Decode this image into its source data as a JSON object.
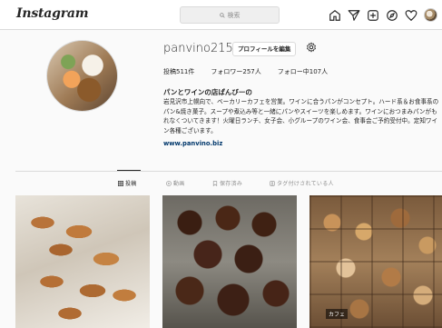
{
  "header": {
    "logo": "Instagram",
    "search_placeholder": "検索"
  },
  "profile": {
    "username": "panvino215",
    "edit_button": "プロフィールを編集",
    "stats": {
      "posts": "投稿511件",
      "followers": "フォロワー257人",
      "following": "フォロー中107人"
    },
    "bio_name": "パンとワインの店ぱんびーの",
    "bio_text": "岩見沢市上幌向で、ベーカリーカフェを営業。ワインに合うパンがコンセプト。ハード系＆お食事系のパン&焼き菓子。スープや煮込み等と一緒にパンやスイーツを楽しめます。ワインにおつまみパンがもれなくついてきます！火曜日ランチ、女子会、小グループのワイン会、食事会ご予約受付中。定知ワイン各種ございます。",
    "link": "www.panvino.biz"
  },
  "tabs": [
    {
      "label": "投稿",
      "icon": "grid-icon"
    },
    {
      "label": "動画",
      "icon": "video-icon"
    },
    {
      "label": "保存済み",
      "icon": "bookmark-icon"
    },
    {
      "label": "タグ付けされている人",
      "icon": "tag-icon"
    }
  ],
  "photos": [
    {
      "subject": "croissants"
    },
    {
      "subject": "canneles"
    },
    {
      "subject": "bakery-shelf",
      "tag": "カフェ"
    }
  ],
  "colors": {
    "link": "#00376b",
    "border": "#dbdbdb",
    "text": "#262626",
    "muted": "#8e8e8e"
  }
}
